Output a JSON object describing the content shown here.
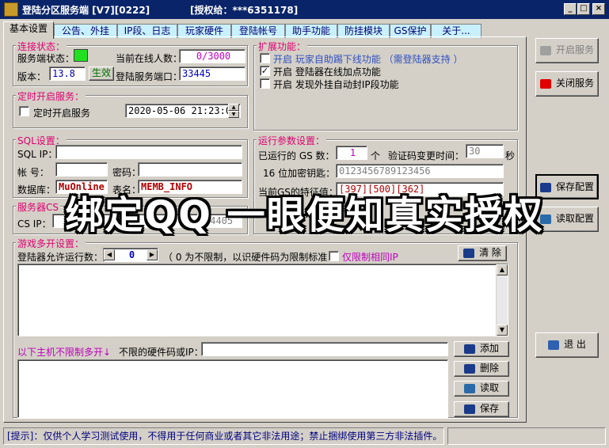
{
  "window": {
    "title": "登陆分区服务端 [V7][0222]",
    "auth_label": "[授权给：***6351178]",
    "minimize": "_",
    "maximize": "□",
    "close": "×"
  },
  "tabs": [
    "基本设置",
    "公告、外挂",
    "IP段、日志",
    "玩家硬件",
    "登陆帐号",
    "助手功能",
    "防挂模块",
    "GS保护",
    "关于..."
  ],
  "connection": {
    "title": "连接状态：",
    "service_status_label": "服务端状态：",
    "status_color": "#20e020",
    "online_label": "当前在线人数：",
    "online_value": "0/3000",
    "version_label": "版本：",
    "version_value": "13.8",
    "apply_button": "生效",
    "port_label": "登陆服务端口：",
    "port_value": "33445"
  },
  "timer": {
    "title": "定时开启服务：",
    "checkbox_label": "定时开启服务",
    "datetime": "2020-05-06 21:23:05"
  },
  "extensions": {
    "title": "扩展功能：",
    "items": [
      {
        "checked": false,
        "label": "开启 玩家自助踢下线功能 （需登陆器支持 ）",
        "color": "#3050c0"
      },
      {
        "checked": true,
        "label": "开启 登陆器在线加点功能",
        "color": "#000000"
      },
      {
        "checked": false,
        "label": "开启 发现外挂自动封IP段功能",
        "color": "#000000"
      }
    ]
  },
  "sql": {
    "title": "SQL设置：",
    "ip_label": "SQL IP：",
    "ip_value": "",
    "account_label": "帐  号：",
    "account_value": "",
    "password_label": "密码：",
    "password_value": "",
    "db_label": "数据库：",
    "db_value": "MuOnline",
    "table_label": "表名：",
    "table_value": "MEMB_INFO"
  },
  "server_cs": {
    "title": "服务器CS",
    "cs_ip_label": "CS IP：",
    "cs_ip_value": "",
    "cs_port_value": "44405"
  },
  "runtime": {
    "title": "运行参数设置：",
    "gs_count_label": "已运行的 GS 数：",
    "gs_count_value": "1",
    "gs_count_unit": "个",
    "captcha_label": "验证码变更时间：",
    "captcha_value": "30",
    "captcha_unit": "秒",
    "key_label": "16 位加密钥匙：",
    "key_value": "0123456789123456",
    "gs_feature_label": "当前GS的特征值：",
    "gs_feature_value": "[397][500][362]"
  },
  "multi_open": {
    "title": "游戏多开设置：",
    "allow_label": "登陆器允许运行数：",
    "allow_value": "0",
    "hint": "（ 0 为不限制，以识硬件码为限制标准",
    "same_ip_label": "仅限制相同IP",
    "clear_button": "清 除",
    "unlimited_label": "以下主机不限制多开↓",
    "hw_label": "不限的硬件码或IP：",
    "hw_value": "",
    "add_button": "添加",
    "delete_button": "删除",
    "read_button": "读取",
    "save_button": "保存"
  },
  "side_buttons": {
    "start": "开启服务",
    "stop": "关闭服务",
    "save_config": "保存配置",
    "read_config": "读取配置",
    "exit": "退  出"
  },
  "status_bar": "[提示]：仅供个人学习测试使用，不得用于任何商业或者其它非法用途；禁止捆绑使用第三方非法插件。",
  "overlay_text": "绑定QQ 一眼便知真实授权",
  "colors": {
    "titlebar": "#0a246a",
    "group_title": "#e00070",
    "field_value_red": "#b00000",
    "field_value_blue": "#0000c0",
    "field_value_magenta": "#c000c0"
  }
}
